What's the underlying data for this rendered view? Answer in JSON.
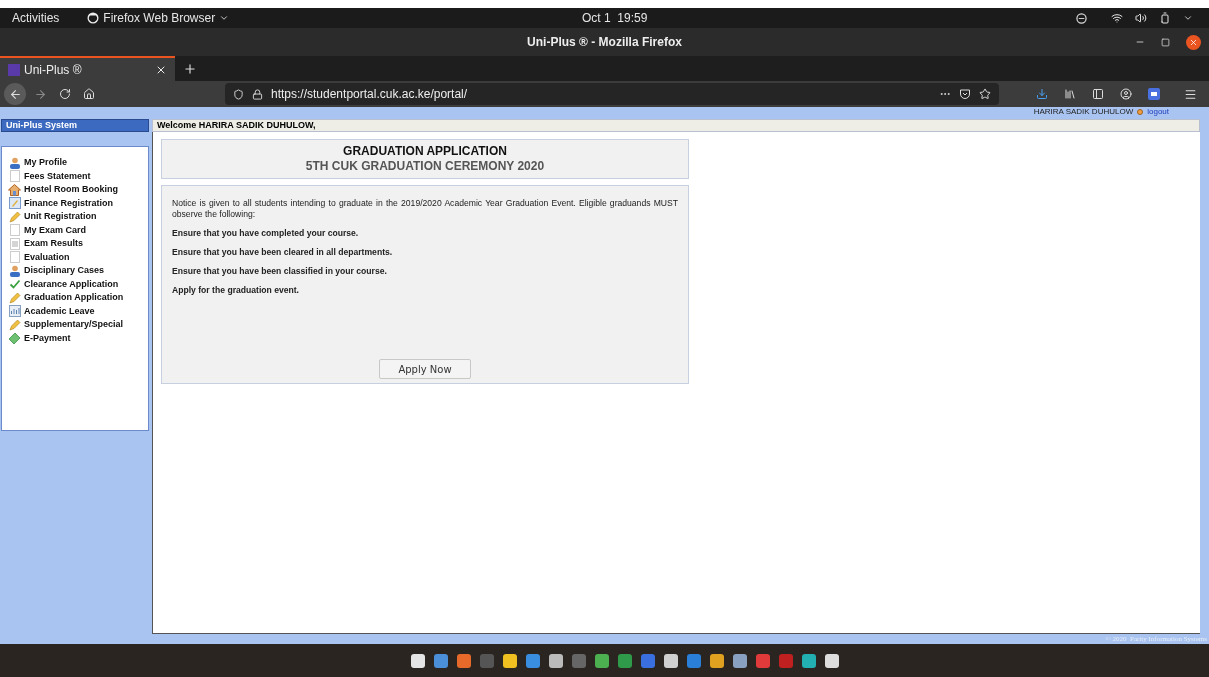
{
  "top_bar": {
    "activities": "Activities",
    "app_menu": "Firefox Web Browser",
    "clock": "Oct 1  19:59"
  },
  "window": {
    "title": "Uni-Plus ® - Mozilla Firefox"
  },
  "tabs": [
    {
      "label": "Uni-Plus ®",
      "selected": true
    }
  ],
  "address_bar": {
    "url": "https://studentportal.cuk.ac.ke/portal/"
  },
  "user_bar": {
    "user": "HARIRA SADIK DUHULOW",
    "logout": "logout"
  },
  "sidebar": {
    "title": "Uni-Plus System",
    "items": [
      {
        "label": "My Profile"
      },
      {
        "label": "Fees Statement"
      },
      {
        "label": "Hostel Room Booking"
      },
      {
        "label": "Finance Registration"
      },
      {
        "label": "Unit Registration"
      },
      {
        "label": "My Exam Card"
      },
      {
        "label": "Exam Results"
      },
      {
        "label": "Evaluation"
      },
      {
        "label": "Disciplinary Cases"
      },
      {
        "label": "Clearance Application"
      },
      {
        "label": "Graduation Application"
      },
      {
        "label": "Academic Leave"
      },
      {
        "label": "Supplementary/Special"
      },
      {
        "label": "E-Payment"
      }
    ]
  },
  "welcome": "Welcome HARIRA SADIK DUHULOW,",
  "header": {
    "title": "GRADUATION APPLICATION",
    "subtitle": "5TH CUK GRADUATION CEREMONY 2020"
  },
  "notice": {
    "intro": "Notice is given to all students intending to graduate in the 2019/2020 Academic Year Graduation Event. Eligible graduands MUST observe the following:",
    "steps": [
      "Ensure that you have completed your course.",
      "Ensure that you have been cleared in all departments.",
      "Ensure that you have been classified in your course.",
      "Apply for the graduation event."
    ],
    "button": "Apply Now"
  },
  "footer": "© 2020  Parity Information Systems"
}
